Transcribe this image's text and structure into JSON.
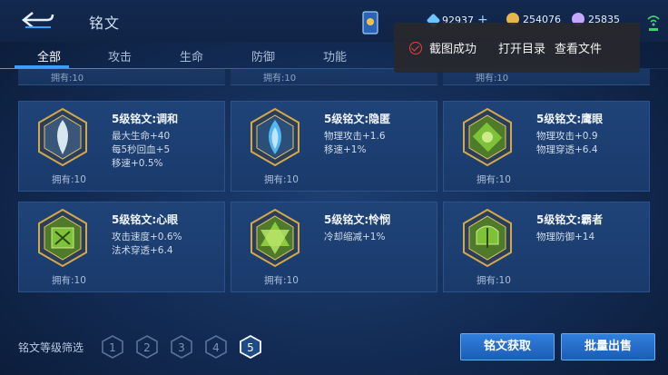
{
  "header": {
    "title": "铭文",
    "currencies": [
      {
        "name": "diamond",
        "value": "92937",
        "color": "#6fc3ff"
      },
      {
        "name": "gold",
        "value": "254076",
        "color": "#e9b44c"
      },
      {
        "name": "crystal",
        "value": "25835",
        "color": "#c7a6ff"
      }
    ]
  },
  "tabs": [
    {
      "label": "全部",
      "active": true
    },
    {
      "label": "攻击",
      "active": false
    },
    {
      "label": "生命",
      "active": false
    },
    {
      "label": "防御",
      "active": false
    },
    {
      "label": "功能",
      "active": false
    }
  ],
  "toast": {
    "message": "截图成功",
    "open_dir": "打开目录",
    "view_file": "查看文件"
  },
  "partial_row": [
    "拥有:10",
    "拥有:10",
    "拥有:10"
  ],
  "cards": [
    {
      "name": "5级铭文:调和",
      "attrs": [
        "最大生命+40",
        "每5秒回血+5",
        "移速+0.5%"
      ],
      "owned": "拥有:10",
      "color": "#d8e6f0"
    },
    {
      "name": "5级铭文:隐匿",
      "attrs": [
        "物理攻击+1.6",
        "移速+1%"
      ],
      "owned": "拥有:10",
      "color": "#56b6f0"
    },
    {
      "name": "5级铭文:鹰眼",
      "attrs": [
        "物理攻击+0.9",
        "物理穿透+6.4"
      ],
      "owned": "拥有:10",
      "color": "#7ec23a"
    },
    {
      "name": "5级铭文:心眼",
      "attrs": [
        "攻击速度+0.6%",
        "法术穿透+6.4"
      ],
      "owned": "拥有:10",
      "color": "#7ec23a"
    },
    {
      "name": "5级铭文:怜悯",
      "attrs": [
        "冷却缩减+1%"
      ],
      "owned": "拥有:10",
      "color": "#8ccc3c"
    },
    {
      "name": "5级铭文:霸者",
      "attrs": [
        "物理防御+14"
      ],
      "owned": "拥有:10",
      "color": "#7ec23a"
    }
  ],
  "filter": {
    "label": "铭文等级筛选",
    "levels": [
      "1",
      "2",
      "3",
      "4",
      "5"
    ],
    "selected": "5"
  },
  "buttons": {
    "acquire": "铭文获取",
    "batch_sell": "批量出售"
  }
}
